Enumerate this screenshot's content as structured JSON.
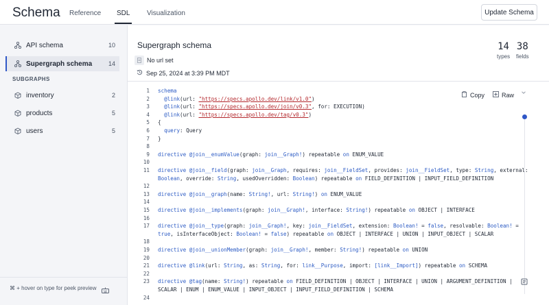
{
  "app": {
    "title": "Schema"
  },
  "tabs": [
    {
      "label": "Reference"
    },
    {
      "label": "SDL"
    },
    {
      "label": "Visualization"
    }
  ],
  "header_button": {
    "label": "Update Schema"
  },
  "sidebar": {
    "items": [
      {
        "label": "API schema",
        "count": "10",
        "icon": "schema-icon"
      },
      {
        "label": "Supergraph schema",
        "count": "14",
        "icon": "schema-icon"
      }
    ],
    "section_label": "SUBGRAPHS",
    "subgraphs": [
      {
        "label": "inventory",
        "count": "2",
        "icon": "cube-icon"
      },
      {
        "label": "products",
        "count": "5",
        "icon": "cube-icon"
      },
      {
        "label": "users",
        "count": "5",
        "icon": "cube-icon"
      }
    ],
    "footer_hint": "⌘ + hover on type for peek preview"
  },
  "schema_header": {
    "title": "Supergraph schema",
    "url_text": "No url set",
    "timestamp": "Sep 25, 2024 at 3:39 PM MDT",
    "types_count": "14",
    "types_label": "types",
    "fields_count": "38",
    "fields_label": "fields"
  },
  "code_actions": {
    "copy_label": "Copy",
    "raw_label": "Raw"
  },
  "code_lines": [
    {
      "n": "1",
      "segs": [
        [
          "kw",
          "schema"
        ]
      ]
    },
    {
      "n": "2",
      "segs": [
        [
          "",
          "  "
        ],
        [
          "kw",
          "@link"
        ],
        [
          "",
          "(url: "
        ],
        [
          "str",
          "\"https://specs.apollo.dev/link/v1.0\""
        ],
        [
          "",
          ")"
        ]
      ]
    },
    {
      "n": "3",
      "segs": [
        [
          "",
          "  "
        ],
        [
          "kw",
          "@link"
        ],
        [
          "",
          "(url: "
        ],
        [
          "str",
          "\"https://specs.apollo.dev/join/v0.3\""
        ],
        [
          "",
          ", for: EXECUTION)"
        ]
      ]
    },
    {
      "n": "4",
      "segs": [
        [
          "",
          "  "
        ],
        [
          "kw",
          "@link"
        ],
        [
          "",
          "(url: "
        ],
        [
          "str",
          "\"https://specs.apollo.dev/tag/v0.3\""
        ],
        [
          "",
          ")"
        ]
      ]
    },
    {
      "n": "5",
      "segs": [
        [
          "",
          "{"
        ]
      ]
    },
    {
      "n": "6",
      "segs": [
        [
          "",
          "  "
        ],
        [
          "ty",
          "query"
        ],
        [
          "",
          ": Query"
        ]
      ]
    },
    {
      "n": "7",
      "segs": [
        [
          "",
          "}"
        ]
      ]
    },
    {
      "n": "8",
      "segs": []
    },
    {
      "n": "9",
      "segs": [
        [
          "kw",
          "directive"
        ],
        [
          "",
          " "
        ],
        [
          "kw",
          "@join__enumValue"
        ],
        [
          "",
          "(graph: "
        ],
        [
          "ty",
          "join__Graph!"
        ],
        [
          "",
          ") repeatable "
        ],
        [
          "kw",
          "on"
        ],
        [
          "",
          " ENUM_VALUE"
        ]
      ]
    },
    {
      "n": "10",
      "segs": []
    },
    {
      "n": "11",
      "segs": [
        [
          "kw",
          "directive"
        ],
        [
          "",
          " "
        ],
        [
          "kw",
          "@join__field"
        ],
        [
          "",
          "(graph: "
        ],
        [
          "ty",
          "join__Graph"
        ],
        [
          "",
          ", requires: "
        ],
        [
          "ty",
          "join__FieldSet"
        ],
        [
          "",
          ", provides: "
        ],
        [
          "ty",
          "join__FieldSet"
        ],
        [
          "",
          ", type: "
        ],
        [
          "ty",
          "String"
        ],
        [
          "",
          ", external:"
        ]
      ]
    },
    {
      "n": "",
      "segs": [
        [
          "ty",
          "Boolean"
        ],
        [
          "",
          ", override: "
        ],
        [
          "ty",
          "String"
        ],
        [
          "",
          ", usedOverridden: "
        ],
        [
          "ty",
          "Boolean"
        ],
        [
          "",
          ") repeatable "
        ],
        [
          "kw",
          "on"
        ],
        [
          "",
          " FIELD_DEFINITION | INPUT_FIELD_DEFINITION"
        ]
      ]
    },
    {
      "n": "12",
      "segs": []
    },
    {
      "n": "13",
      "segs": [
        [
          "kw",
          "directive"
        ],
        [
          "",
          " "
        ],
        [
          "kw",
          "@join__graph"
        ],
        [
          "",
          "(name: "
        ],
        [
          "ty",
          "String!"
        ],
        [
          "",
          ", url: "
        ],
        [
          "ty",
          "String!"
        ],
        [
          "",
          ") "
        ],
        [
          "kw",
          "on"
        ],
        [
          "",
          " ENUM_VALUE"
        ]
      ]
    },
    {
      "n": "14",
      "segs": []
    },
    {
      "n": "15",
      "segs": [
        [
          "kw",
          "directive"
        ],
        [
          "",
          " "
        ],
        [
          "kw",
          "@join__implements"
        ],
        [
          "",
          "(graph: "
        ],
        [
          "ty",
          "join__Graph!"
        ],
        [
          "",
          ", interface: "
        ],
        [
          "ty",
          "String!"
        ],
        [
          "",
          ") repeatable "
        ],
        [
          "kw",
          "on"
        ],
        [
          "",
          " OBJECT | INTERFACE"
        ]
      ]
    },
    {
      "n": "16",
      "segs": []
    },
    {
      "n": "17",
      "segs": [
        [
          "kw",
          "directive"
        ],
        [
          "",
          " "
        ],
        [
          "kw",
          "@join__type"
        ],
        [
          "",
          "(graph: "
        ],
        [
          "ty",
          "join__Graph!"
        ],
        [
          "",
          ", key: "
        ],
        [
          "ty",
          "join__FieldSet"
        ],
        [
          "",
          ", extension: "
        ],
        [
          "ty",
          "Boolean!"
        ],
        [
          "",
          " = "
        ],
        [
          "lit",
          "false"
        ],
        [
          "",
          ", resolvable: "
        ],
        [
          "ty",
          "Boolean!"
        ],
        [
          "",
          " ="
        ]
      ]
    },
    {
      "n": "",
      "segs": [
        [
          "lit",
          "true"
        ],
        [
          "",
          ", isInterfaceObject: "
        ],
        [
          "ty",
          "Boolean!"
        ],
        [
          "",
          " = "
        ],
        [
          "lit",
          "false"
        ],
        [
          "",
          ") repeatable "
        ],
        [
          "kw",
          "on"
        ],
        [
          "",
          " OBJECT | INTERFACE | UNION | INPUT_OBJECT | SCALAR"
        ]
      ]
    },
    {
      "n": "18",
      "segs": []
    },
    {
      "n": "19",
      "segs": [
        [
          "kw",
          "directive"
        ],
        [
          "",
          " "
        ],
        [
          "kw",
          "@join__unionMember"
        ],
        [
          "",
          "(graph: "
        ],
        [
          "ty",
          "join__Graph!"
        ],
        [
          "",
          ", member: "
        ],
        [
          "ty",
          "String!"
        ],
        [
          "",
          ") repeatable "
        ],
        [
          "kw",
          "on"
        ],
        [
          "",
          " UNION"
        ]
      ]
    },
    {
      "n": "20",
      "segs": []
    },
    {
      "n": "21",
      "segs": [
        [
          "kw",
          "directive"
        ],
        [
          "",
          " "
        ],
        [
          "kw",
          "@link"
        ],
        [
          "",
          "(url: "
        ],
        [
          "ty",
          "String"
        ],
        [
          "",
          ", as: "
        ],
        [
          "ty",
          "String"
        ],
        [
          "",
          ", for: "
        ],
        [
          "ty",
          "link__Purpose"
        ],
        [
          "",
          ", import: "
        ],
        [
          "ty",
          "[link__Import]"
        ],
        [
          "",
          ") repeatable "
        ],
        [
          "kw",
          "on"
        ],
        [
          "",
          " SCHEMA"
        ]
      ]
    },
    {
      "n": "22",
      "segs": []
    },
    {
      "n": "23",
      "segs": [
        [
          "kw",
          "directive"
        ],
        [
          "",
          " "
        ],
        [
          "kw",
          "@tag"
        ],
        [
          "",
          "(name: "
        ],
        [
          "ty",
          "String!"
        ],
        [
          "",
          ") repeatable "
        ],
        [
          "kw",
          "on"
        ],
        [
          "",
          " FIELD_DEFINITION | OBJECT | INTERFACE | UNION | ARGUMENT_DEFINITION |"
        ]
      ]
    },
    {
      "n": "",
      "segs": [
        [
          "",
          "SCALAR | ENUM | ENUM_VALUE | INPUT_OBJECT | INPUT_FIELD_DEFINITION | SCHEMA"
        ]
      ]
    },
    {
      "n": "24",
      "segs": []
    }
  ],
  "colors": {
    "accent": "#2f57c7",
    "keyword": "#2c5bc4",
    "string": "#b3262b"
  }
}
